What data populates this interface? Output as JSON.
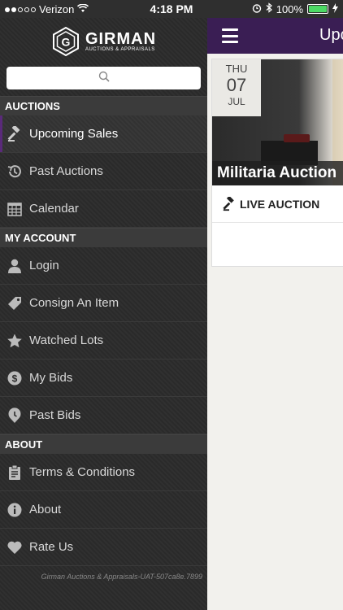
{
  "status": {
    "carrier": "Verizon",
    "time": "4:18 PM",
    "battery": "100%",
    "signal_bars_filled": 2,
    "signal_bars_total": 5
  },
  "brand": {
    "name": "GIRMAN",
    "tagline": "AUCTIONS & APPRAISALS",
    "accent": "#3a1e54"
  },
  "search": {
    "placeholder": ""
  },
  "sections": {
    "auctions": "AUCTIONS",
    "my_account": "MY ACCOUNT",
    "about": "ABOUT"
  },
  "menu": {
    "upcoming_sales": "Upcoming Sales",
    "past_auctions": "Past Auctions",
    "calendar": "Calendar",
    "login": "Login",
    "consign": "Consign An Item",
    "watched_lots": "Watched Lots",
    "my_bids": "My Bids",
    "past_bids": "Past Bids",
    "terms": "Terms & Conditions",
    "about": "About",
    "rate_us": "Rate Us"
  },
  "version": "Girman Auctions & Appraisals-UAT-507ca8e.7899",
  "main": {
    "title": "Upcoming Sales",
    "card": {
      "dow": "THU",
      "day": "07",
      "month": "JUL",
      "title": "Militaria Auction",
      "type": "LIVE AUCTION"
    }
  }
}
